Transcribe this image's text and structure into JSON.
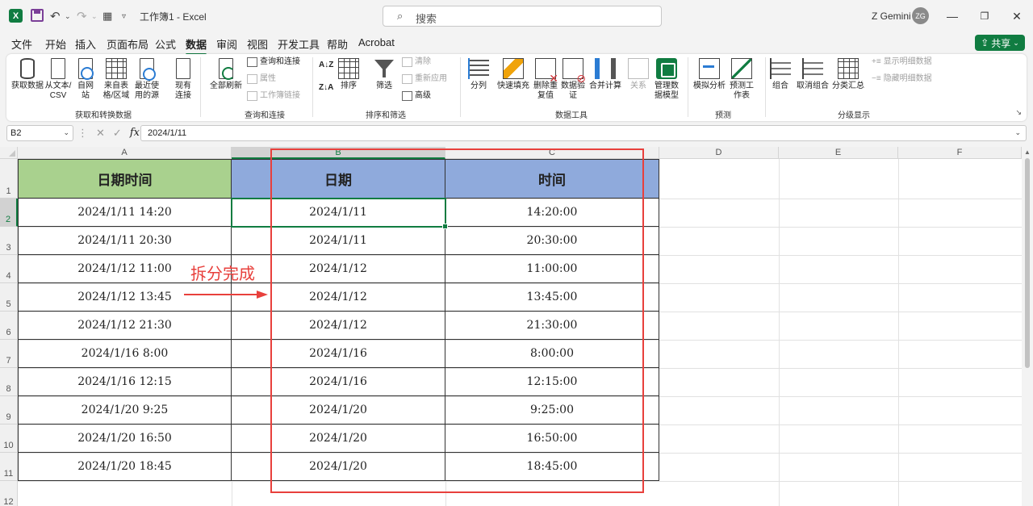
{
  "app": {
    "logo": "X",
    "title": "工作簿1 - Excel",
    "search_placeholder": "搜索",
    "user_name": "Z Gemini",
    "user_initials": "ZG",
    "share_label": "共享"
  },
  "menu_tabs": [
    "文件",
    "开始",
    "插入",
    "页面布局",
    "公式",
    "数据",
    "审阅",
    "视图",
    "开发工具",
    "帮助",
    "Acrobat"
  ],
  "active_tab": "数据",
  "ribbon": {
    "get_data": "获取数据",
    "from_text_csv": "从文本/CSV",
    "from_web": "自网站",
    "from_table_range": "来自表格/区域",
    "recent_sources": "最近使用的源",
    "existing_connections": "现有连接",
    "group_get_transform": "获取和转换数据",
    "refresh_all": "全部刷新",
    "queries_connections": "查询和连接",
    "properties": "属性",
    "workbook_links": "工作簿链接",
    "group_queries": "查询和连接",
    "sort_az": "A↓Z",
    "sort_za": "Z↓A",
    "sort": "排序",
    "filter": "筛选",
    "clear": "清除",
    "reapply": "重新应用",
    "advanced": "高级",
    "group_sort_filter": "排序和筛选",
    "text_to_columns": "分列",
    "flash_fill": "快速填充",
    "remove_duplicates": "删除重复值",
    "data_validation": "数据验证",
    "consolidate": "合并计算",
    "relationships": "关系",
    "data_model": "管理数据模型",
    "group_data_tools": "数据工具",
    "what_if": "模拟分析",
    "forecast_sheet": "预测工作表",
    "group_forecast": "预测",
    "group": "组合",
    "ungroup": "取消组合",
    "subtotal": "分类汇总",
    "show_detail": "显示明细数据",
    "hide_detail": "隐藏明细数据",
    "group_outline": "分级显示"
  },
  "formula_bar": {
    "name_box": "B2",
    "fx": "fx",
    "formula": "2024/1/11"
  },
  "columns": [
    "A",
    "B",
    "C",
    "D",
    "E",
    "F"
  ],
  "rows": [
    "1",
    "2",
    "3",
    "4",
    "5",
    "6",
    "7",
    "8",
    "9",
    "10",
    "11",
    "12"
  ],
  "table": {
    "headers": [
      "日期时间",
      "日期",
      "时间"
    ],
    "header_colors": [
      "#a9d18e",
      "#8faadc",
      "#8faadc"
    ],
    "data": [
      [
        "2024/1/11 14:20",
        "2024/1/11",
        "14:20:00"
      ],
      [
        "2024/1/11 20:30",
        "2024/1/11",
        "20:30:00"
      ],
      [
        "2024/1/12 11:00",
        "2024/1/12",
        "11:00:00"
      ],
      [
        "2024/1/12 13:45",
        "2024/1/12",
        "13:45:00"
      ],
      [
        "2024/1/12 21:30",
        "2024/1/12",
        "21:30:00"
      ],
      [
        "2024/1/16 8:00",
        "2024/1/16",
        "8:00:00"
      ],
      [
        "2024/1/16 12:15",
        "2024/1/16",
        "12:15:00"
      ],
      [
        "2024/1/20 9:25",
        "2024/1/20",
        "9:25:00"
      ],
      [
        "2024/1/20 16:50",
        "2024/1/20",
        "16:50:00"
      ],
      [
        "2024/1/20 18:45",
        "2024/1/20",
        "18:45:00"
      ]
    ]
  },
  "annotation": {
    "text": "拆分完成",
    "color": "#e8403c"
  },
  "accent_color": "#107c41"
}
